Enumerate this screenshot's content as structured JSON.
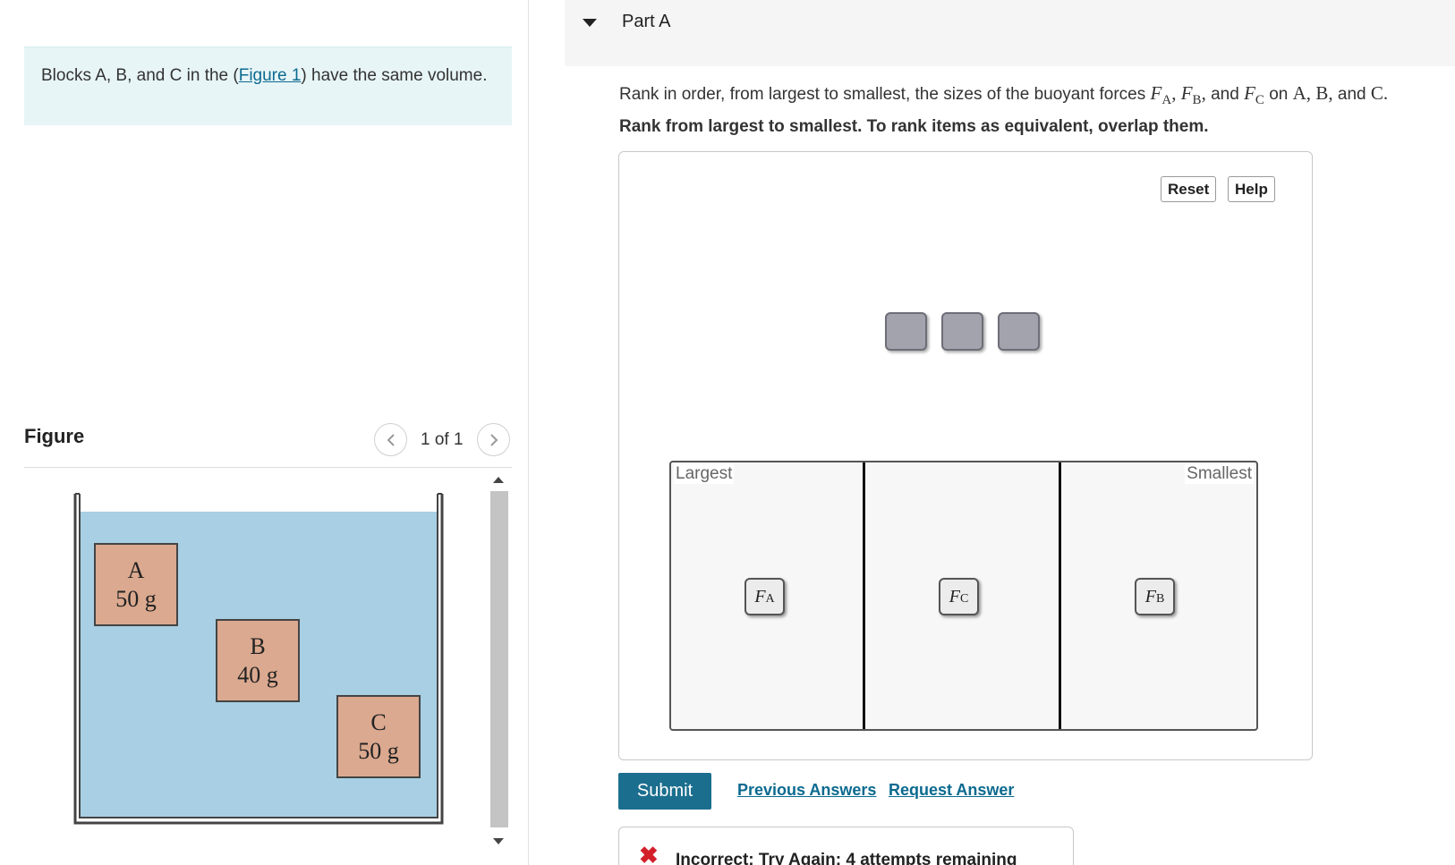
{
  "intro": {
    "text_before": "Blocks A, B, and C in the (",
    "link": "Figure 1",
    "text_after": ") have the same volume."
  },
  "figure": {
    "heading": "Figure",
    "pager": "1 of 1",
    "blocks": [
      {
        "letter": "A",
        "mass": "50 g"
      },
      {
        "letter": "B",
        "mass": "40 g"
      },
      {
        "letter": "C",
        "mass": "50 g"
      }
    ],
    "colors": {
      "water": "#a8cfe3",
      "block": "#dba98f",
      "block_border": "#444444",
      "tank": "#444444"
    }
  },
  "part": {
    "title": "Part A",
    "question": {
      "prefix": "Rank in order, from largest to smallest, the sizes of the buoyant forces",
      "f_a_sub": "A",
      "f_b_sub": "B",
      "f_c_sub": "C",
      "and_word": "and",
      "on_word": "on",
      "block_a": "A",
      "block_b": "B",
      "block_c": "C"
    },
    "instruction": "Rank from largest to smallest. To rank items as equivalent, overlap them."
  },
  "widget": {
    "reset_label": "Reset",
    "help_label": "Help",
    "largest_label": "Largest",
    "smallest_label": "Smallest",
    "tokens": [
      {
        "symbol": "F",
        "sub": "A"
      },
      {
        "symbol": "F",
        "sub": "C"
      },
      {
        "symbol": "F",
        "sub": "B"
      }
    ],
    "colors": {
      "slot": "#a3a3ad",
      "token": "#ececec"
    }
  },
  "actions": {
    "submit_label": "Submit",
    "previous_answers": "Previous Answers",
    "request_answer": "Request Answer"
  },
  "feedback": {
    "icon": "close-x-icon",
    "text": "Incorrect; Try Again; 4 attempts remaining",
    "color": "#d21f2a"
  },
  "accent_color": "#1b6e8e"
}
